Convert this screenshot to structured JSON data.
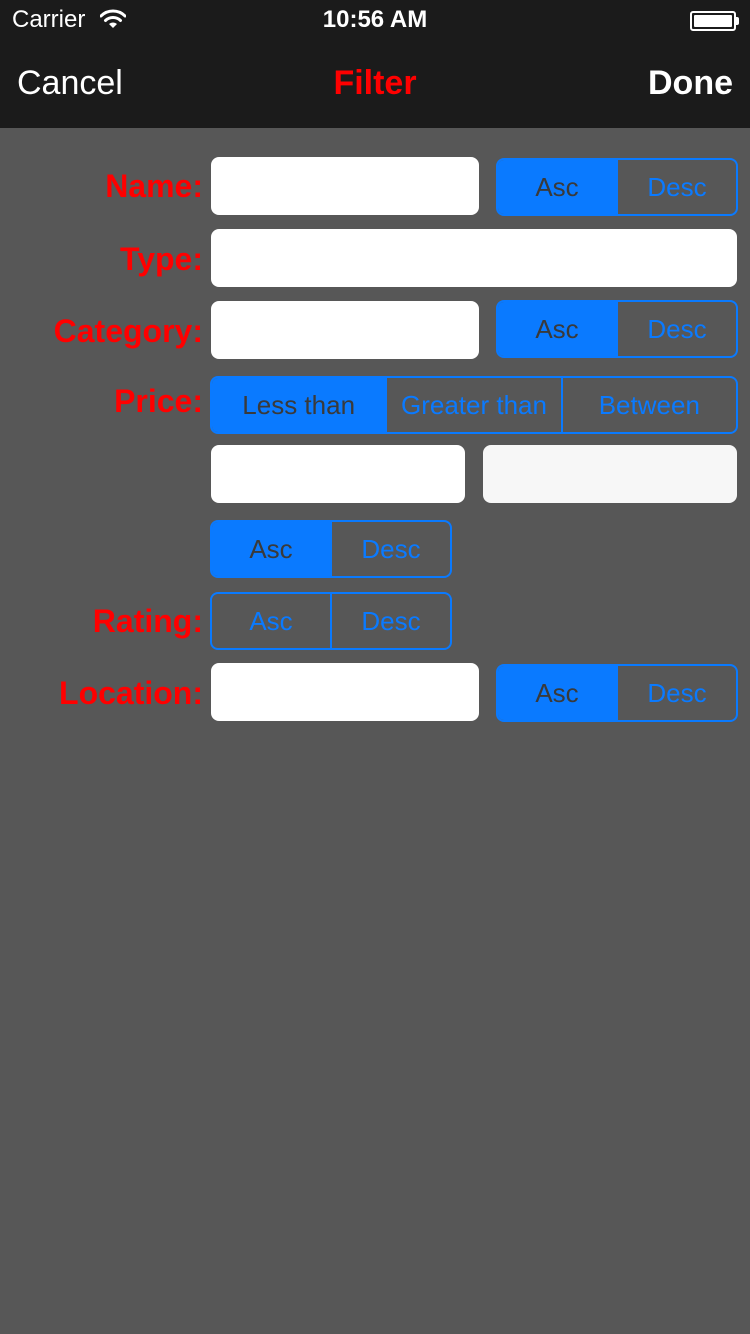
{
  "status_bar": {
    "carrier": "Carrier",
    "time": "10:56 AM",
    "wifi_icon": "wifi-icon",
    "battery_icon": "battery-icon"
  },
  "nav": {
    "cancel_label": "Cancel",
    "title": "Filter",
    "done_label": "Done"
  },
  "colors": {
    "label_red": "#ff0000",
    "accent_blue": "#0a7aff",
    "background": "#575757",
    "bar": "#1b1b1b"
  },
  "form": {
    "name": {
      "label": "Name:",
      "value": "",
      "sort": {
        "options": [
          "Asc",
          "Desc"
        ],
        "selected": "Asc"
      }
    },
    "type": {
      "label": "Type:",
      "value": ""
    },
    "category": {
      "label": "Category:",
      "value": "",
      "sort": {
        "options": [
          "Asc",
          "Desc"
        ],
        "selected": "Asc"
      }
    },
    "price": {
      "label": "Price:",
      "mode": {
        "options": [
          "Less than",
          "Greater than",
          "Between"
        ],
        "selected": "Less than"
      },
      "min_value": "",
      "max_value": "",
      "sort": {
        "options": [
          "Asc",
          "Desc"
        ],
        "selected": "Asc"
      }
    },
    "rating": {
      "label": "Rating:",
      "sort": {
        "options": [
          "Asc",
          "Desc"
        ],
        "selected": null
      }
    },
    "location": {
      "label": "Location:",
      "value": "",
      "sort": {
        "options": [
          "Asc",
          "Desc"
        ],
        "selected": "Asc"
      }
    }
  }
}
